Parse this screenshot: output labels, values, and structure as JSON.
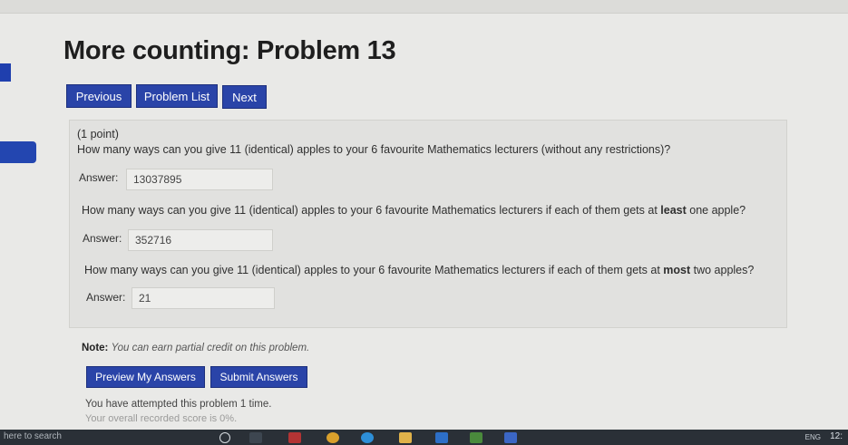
{
  "page": {
    "title": "More counting: Problem 13"
  },
  "nav": {
    "previous": "Previous",
    "problem_list": "Problem List",
    "next": "Next"
  },
  "problem": {
    "points": "(1 point)",
    "questions": [
      {
        "text_parts": [
          "How many ways can you give 11 (identical) apples to your 6 favourite Mathematics lecturers (without any restrictions)?"
        ],
        "answer_label": "Answer:",
        "answer": "13037895"
      },
      {
        "text_before": "How many ways can you give 11 (identical) apples to your 6 favourite Mathematics lecturers if each of them gets at ",
        "bold": "least",
        "text_after": " one apple?",
        "answer_label": "Answer:",
        "answer": "352716"
      },
      {
        "text_before": "How many ways can you give 11 (identical) apples to your 6 favourite Mathematics lecturers if each of them gets at ",
        "bold": "most",
        "text_after": " two apples?",
        "answer_label": "Answer:",
        "answer": "21"
      }
    ]
  },
  "note": {
    "label": "Note:",
    "text": "You can earn partial credit on this problem."
  },
  "actions": {
    "preview": "Preview My Answers",
    "submit": "Submit Answers"
  },
  "status": {
    "attempts": "You have attempted this problem 1 time.",
    "cutoff": "Your overall recorded score is 0%."
  },
  "taskbar": {
    "search": "here to search",
    "lang": "ENG",
    "clock": "12:"
  },
  "colors": {
    "accent": "#2a44a8",
    "panel": "#e1e1df",
    "taskbar": "#2a3037"
  }
}
